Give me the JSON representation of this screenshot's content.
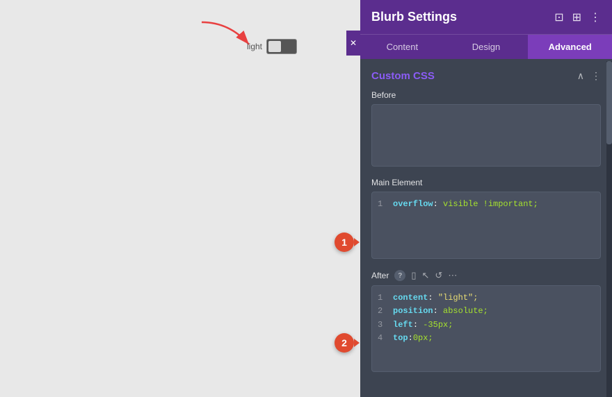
{
  "panel": {
    "title": "Blurb Settings",
    "tabs": [
      {
        "id": "content",
        "label": "Content",
        "active": false
      },
      {
        "id": "design",
        "label": "Design",
        "active": false
      },
      {
        "id": "advanced",
        "label": "Advanced",
        "active": true
      }
    ],
    "section": {
      "title": "Custom CSS",
      "fields": {
        "before_label": "Before",
        "main_element_label": "Main Element",
        "after_label": "After"
      }
    }
  },
  "code": {
    "main_element": [
      {
        "num": "1",
        "prop": "overflow",
        "value": "visible !important;"
      }
    ],
    "after": [
      {
        "num": "1",
        "prop": "content",
        "value": "\"light\";"
      },
      {
        "num": "2",
        "prop": "position",
        "value": "absolute;"
      },
      {
        "num": "3",
        "prop": "left",
        "value": "-35px;"
      },
      {
        "num": "4",
        "prop": "top",
        "value": "0px;"
      }
    ]
  },
  "canvas": {
    "light_label": "light",
    "badge1": "1",
    "badge2": "2"
  },
  "icons": {
    "expand": "⊡",
    "columns": "⊞",
    "more": "⋮",
    "chevron_up": "∧",
    "help": "?",
    "copy": "⧉",
    "cursor": "↖",
    "undo": "↺",
    "dots": "⋯",
    "close": "✕"
  }
}
